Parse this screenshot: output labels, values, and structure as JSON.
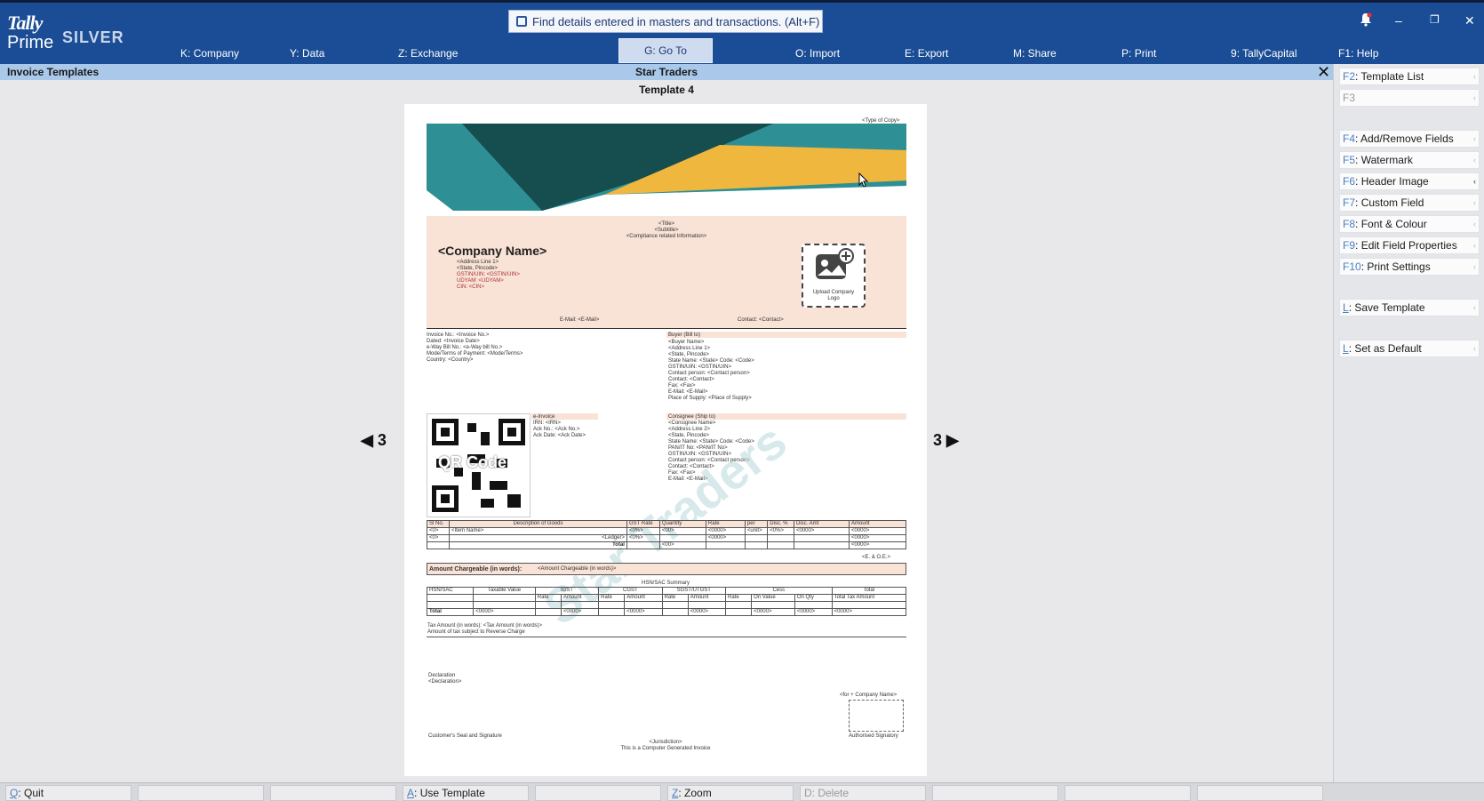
{
  "app": {
    "logo_tally": "Tally",
    "logo_prime": "Prime",
    "edition": "SILVER"
  },
  "search": {
    "placeholder": "Find details entered in masters and transactions. (Alt+F)"
  },
  "menu": [
    {
      "key": "K",
      "label": "Company"
    },
    {
      "key": "Y",
      "label": "Data"
    },
    {
      "key": "Z",
      "label": "Exchange"
    },
    {
      "key": "G",
      "label": "Go To"
    },
    {
      "key": "O",
      "label": "Import"
    },
    {
      "key": "E",
      "label": "Export"
    },
    {
      "key": "M",
      "label": "Share"
    },
    {
      "key": "P",
      "label": "Print"
    },
    {
      "key": "9",
      "label": "TallyCapital"
    },
    {
      "key": "F1",
      "label": "Help"
    }
  ],
  "subbar": {
    "left": "Invoice Templates",
    "center": "Star Traders",
    "template": "Template 4"
  },
  "right_panel": [
    {
      "key": "F2",
      "label": "Template List",
      "enabled": true
    },
    {
      "key": "F3",
      "label": "",
      "enabled": false
    },
    {
      "key": "F4",
      "label": "Add/Remove Fields",
      "enabled": true
    },
    {
      "key": "F5",
      "label": "Watermark",
      "enabled": true
    },
    {
      "key": "F6",
      "label": "Header Image",
      "enabled": true
    },
    {
      "key": "F7",
      "label": "Custom Field",
      "enabled": true
    },
    {
      "key": "F8",
      "label": "Font & Colour",
      "enabled": true
    },
    {
      "key": "F9",
      "label": "Edit Field Properties",
      "enabled": true
    },
    {
      "key": "F10",
      "label": "Print Settings",
      "enabled": true
    },
    {
      "key": "L",
      "label": "Save Template",
      "enabled": true
    },
    {
      "key": "L",
      "label": "Set as Default",
      "enabled": true
    }
  ],
  "bottom": [
    {
      "key": "Q",
      "label": "Quit"
    },
    {
      "key": "",
      "label": ""
    },
    {
      "key": "",
      "label": ""
    },
    {
      "key": "A",
      "label": "Use Template"
    },
    {
      "key": "",
      "label": ""
    },
    {
      "key": "Z",
      "label": "Zoom"
    },
    {
      "key": "D",
      "label": "Delete"
    },
    {
      "key": "",
      "label": ""
    },
    {
      "key": "",
      "label": ""
    },
    {
      "key": "",
      "label": ""
    }
  ],
  "nav": {
    "left": "3",
    "right": "3"
  },
  "invoice": {
    "type_copy": "<Type of Copy>",
    "title": "<Title>",
    "subtitle": "<Subtitle>",
    "compliance": "<Compliance related Information>",
    "company_name": "<Company Name>",
    "company_lines": [
      "<Address Line 1>",
      "<State, Pincode>",
      "GSTIN/UIN: <GSTIN/UIN>",
      "UDYAM: <UDYAM>",
      "CIN: <CIN>"
    ],
    "email": "E-Mail: <E-Mail>",
    "contact": "Contact: <Contact>",
    "upload_logo": "Upload Company Logo",
    "inv_lines": [
      "Invoice No.: <Invoice No.>",
      "Dated: <Invoice Date>",
      "e-Way Bill No.: <e-Way bill No.>",
      "Mode/Terms of Payment: <Mode/Terms>",
      "Country: <Country>"
    ],
    "buyer_head": "Buyer (Bill to)",
    "buyer_lines": [
      "<Buyer Name>",
      "<Address Line 1>",
      "<State, Pincode>",
      "State Name: <State> Code: <Code>",
      "GSTIN/UIN: <GSTIN/UIN>",
      "Contact person: <Contact person>",
      "Contact: <Contact>",
      "Fax: <Fax>",
      "E-Mail: <E-Mail>",
      "Place of Supply: <Place of Supply>"
    ],
    "einv_head": "e-Invoice",
    "einv_lines": [
      "IRN: <IRN>",
      "Ack No.: <Ack No.>",
      "Ack Date: <Ack Date>"
    ],
    "qr": "QR Code",
    "consignee_head": "Consignee (Ship to)",
    "consignee_lines": [
      "<Consignee Name>",
      "<Address Line 2>",
      "<State, Pincode>",
      "State Name: <State> Code: <Code>",
      "PAN/IT No: <PAN/IT No>",
      "GSTIN/UIN: <GSTIN/UIN>",
      "Contact person: <Contact person>",
      "Contact: <Contact>",
      "Fax: <Fax>",
      "E-Mail: <E-Mail>"
    ],
    "watermark": "Star Traders",
    "items_head": [
      "Sl No.",
      "Description of Goods",
      "GST Rate",
      "Quantity",
      "Rate",
      "per",
      "Disc. %",
      "Disc. Amt",
      "Amount"
    ],
    "item_row": [
      "<0>",
      "<Item Name>",
      "<0%>",
      "<00>",
      "<0000>",
      "<unit>",
      "<0%>",
      "<0000>",
      "<0000>"
    ],
    "ledger_row": [
      "<0>",
      "<Ledger>",
      "<0%>",
      "",
      "<0000>",
      "",
      "",
      "",
      "<0000>"
    ],
    "total_label": "Total",
    "total_qty": "<00>",
    "total_amt": "<0000>",
    "eoe": "<E. & O.E.>",
    "amount_words_label": "Amount Chargeable (in words):",
    "amount_words": "<Amount Chargeable (in words)>",
    "hsn_title": "HSN/SAC Summary",
    "hsn_head": [
      "HSN/SAC",
      "Taxable Value",
      "IGST",
      "CGST",
      "SGST/UTGST",
      "Cess",
      "Total"
    ],
    "hsn_sub": [
      "Rate",
      "Amount",
      "Rate",
      "Amount",
      "Rate",
      "Amount",
      "Rate",
      "On Value",
      "On Qty",
      "Total Tax Amount"
    ],
    "tax_words": "Tax Amount (in words): <Tax Amount (in words)>",
    "reverse": "Amount of tax subject to Reverse Charge",
    "declaration": "Declaration",
    "declaration_val": "<Declaration>",
    "for_company": "<for + Company Name>",
    "auth": "Authorised Signatory",
    "customer_seal": "Customer's Seal and Signature",
    "jurisdiction": "<Jurisdiction>",
    "computer_gen": "This is a Computer Generated Invoice"
  }
}
